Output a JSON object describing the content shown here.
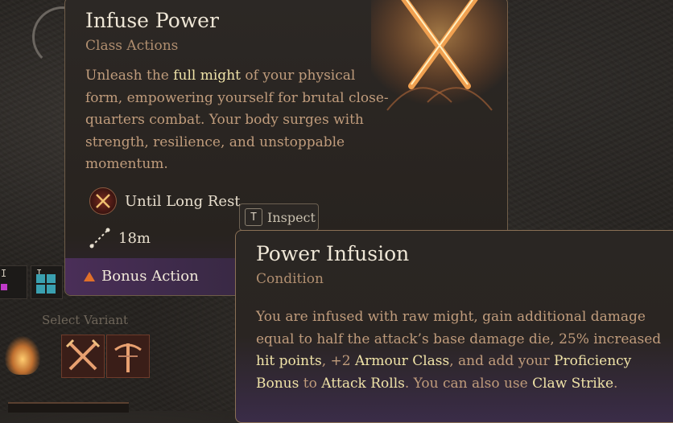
{
  "main_tooltip": {
    "title": "Infuse Power",
    "subtitle": "Class Actions",
    "description": {
      "part1": "Unleash the ",
      "highlight": "full might",
      "part2": " of your physical form, empowering yourself for brutal close-quarters combat. Your body surges with strength, resilience, and unstoppable momentum."
    },
    "duration": {
      "icon": "crossed-swords-icon",
      "label": "Until Long Rest"
    },
    "range": {
      "icon": "range-icon",
      "label": "18m"
    },
    "cost": {
      "icon": "triangle-icon",
      "label": "Bonus Action",
      "color": "#e0702a"
    }
  },
  "inspect_button": {
    "key": "T",
    "label": "Inspect"
  },
  "hotbar": {
    "keys": [
      "I",
      "I"
    ]
  },
  "variant": {
    "label": "Select Variant",
    "slots": [
      "flame-icon",
      "crossed-swords-icon",
      "crossbow-icon"
    ]
  },
  "condition_tooltip": {
    "title": "Power Infusion",
    "subtitle": "Condition",
    "description": [
      {
        "text": "You are infused with raw might, gain additional damage equal to half the attack’s base damage die, 25% increased ",
        "hl": false
      },
      {
        "text": "hit points",
        "hl": true
      },
      {
        "text": ", +2 ",
        "hl": false
      },
      {
        "text": "Armour Class",
        "hl": true
      },
      {
        "text": ", and add your ",
        "hl": false
      },
      {
        "text": "Proficiency Bonus",
        "hl": true
      },
      {
        "text": " to ",
        "hl": false
      },
      {
        "text": "Attack Rolls",
        "hl": true
      },
      {
        "text": ". You can also use ",
        "hl": false
      },
      {
        "text": "Claw Strike",
        "hl": true
      },
      {
        "text": ".",
        "hl": false
      }
    ]
  },
  "colors": {
    "highlight": "#f0e3a8",
    "body_text": "#c09c7c",
    "subtitle": "#b08e6f",
    "footer_purple": "#4a2e58"
  }
}
